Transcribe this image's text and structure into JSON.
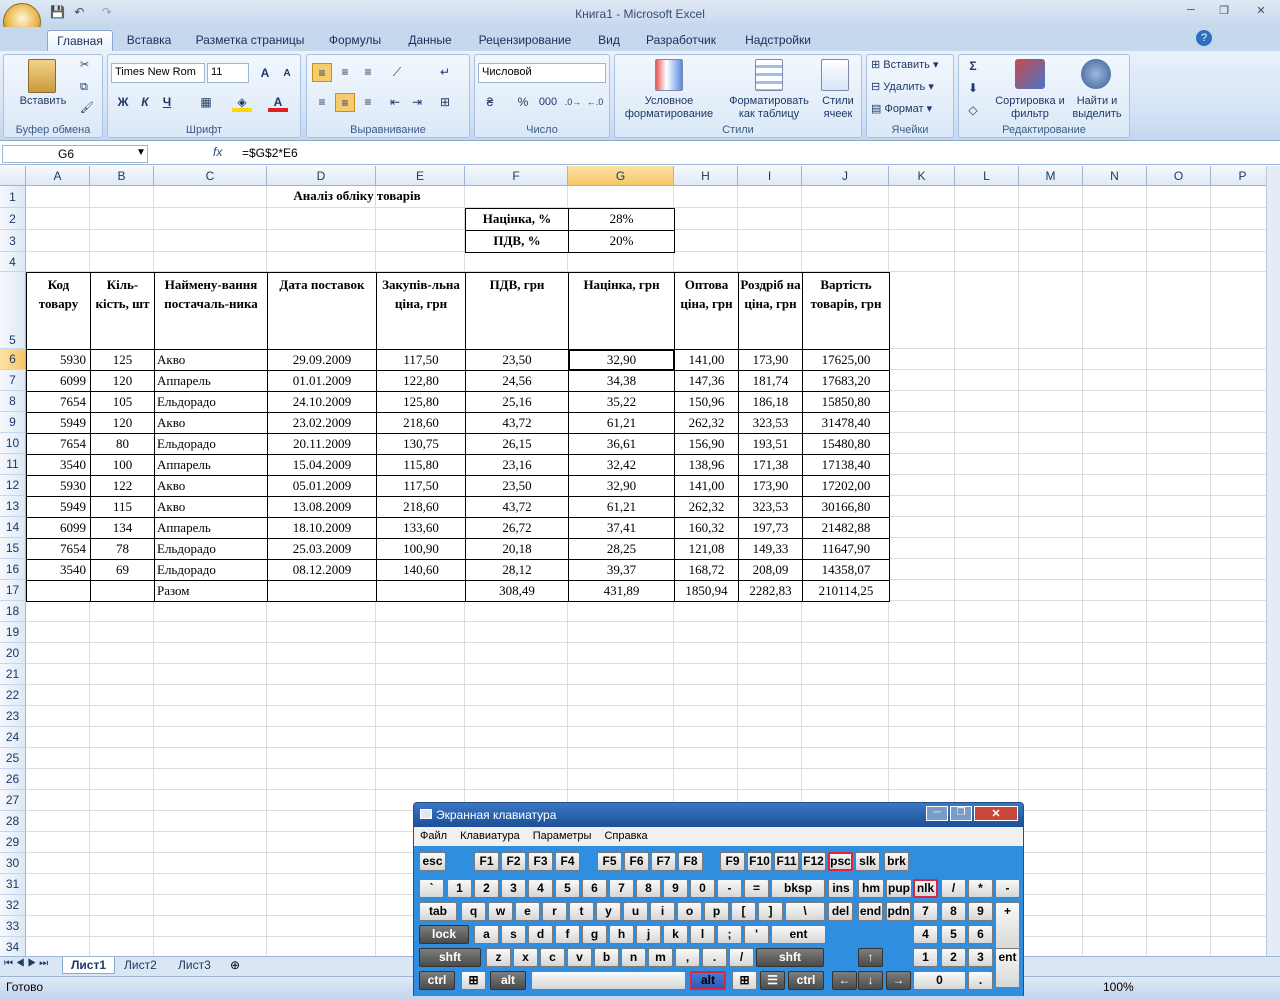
{
  "window": {
    "title": "Книга1 - Microsoft Excel"
  },
  "qat": {
    "save": "💾",
    "undo": "↶",
    "redo": "↷"
  },
  "ribbon": {
    "tabs": [
      "Главная",
      "Вставка",
      "Разметка страницы",
      "Формулы",
      "Данные",
      "Рецензирование",
      "Вид",
      "Разработчик",
      "Надстройки"
    ],
    "active_tab": "Главная",
    "groups": {
      "clipboard": {
        "label": "Буфер обмена",
        "paste": "Вставить"
      },
      "font": {
        "label": "Шрифт",
        "font_name": "Times New Rom",
        "font_size": "11",
        "bold": "Ж",
        "italic": "К",
        "underline": "Ч"
      },
      "alignment": {
        "label": "Выравнивание"
      },
      "number": {
        "label": "Число",
        "format": "Числовой",
        "percent": "%",
        "thousands": "000"
      },
      "styles": {
        "label": "Стили",
        "conditional": "Условное форматирование",
        "as_table": "Форматировать как таблицу",
        "cell_styles": "Стили ячеек"
      },
      "cells": {
        "label": "Ячейки",
        "insert": "Вставить",
        "delete": "Удалить",
        "format": "Формат"
      },
      "editing": {
        "label": "Редактирование",
        "sum": "Σ",
        "sort": "Сортировка и фильтр",
        "find": "Найти и выделить"
      }
    }
  },
  "formula_bar": {
    "name_box": "G6",
    "fx": "fx",
    "formula": "=$G$2*E6"
  },
  "columns": [
    "A",
    "B",
    "C",
    "D",
    "E",
    "F",
    "G",
    "H",
    "I",
    "J",
    "K",
    "L",
    "M",
    "N",
    "O",
    "P"
  ],
  "selected_column": "G",
  "selected_row": 6,
  "sheet": {
    "title": "Аналіз обліку товарів",
    "markup_label": "Націнка, %",
    "markup_value": "28%",
    "vat_label": "ПДВ, %",
    "vat_value": "20%",
    "headers": [
      "Код товару",
      "Кіль-кість, шт",
      "Наймену-вання постачаль-ника",
      "Дата поставок",
      "Закупів-льна ціна, грн",
      "ПДВ, грн",
      "Націнка, грн",
      "Оптова ціна, грн",
      "Роздріб на ціна, грн",
      "Вартість товарів, грн"
    ],
    "rows": [
      [
        "5930",
        "125",
        "Акво",
        "29.09.2009",
        "117,50",
        "23,50",
        "32,90",
        "141,00",
        "173,90",
        "17625,00"
      ],
      [
        "6099",
        "120",
        "Аппарель",
        "01.01.2009",
        "122,80",
        "24,56",
        "34,38",
        "147,36",
        "181,74",
        "17683,20"
      ],
      [
        "7654",
        "105",
        "Ельдорадо",
        "24.10.2009",
        "125,80",
        "25,16",
        "35,22",
        "150,96",
        "186,18",
        "15850,80"
      ],
      [
        "5949",
        "120",
        "Акво",
        "23.02.2009",
        "218,60",
        "43,72",
        "61,21",
        "262,32",
        "323,53",
        "31478,40"
      ],
      [
        "7654",
        "80",
        "Ельдорадо",
        "20.11.2009",
        "130,75",
        "26,15",
        "36,61",
        "156,90",
        "193,51",
        "15480,80"
      ],
      [
        "3540",
        "100",
        "Аппарель",
        "15.04.2009",
        "115,80",
        "23,16",
        "32,42",
        "138,96",
        "171,38",
        "17138,40"
      ],
      [
        "5930",
        "122",
        "Акво",
        "05.01.2009",
        "117,50",
        "23,50",
        "32,90",
        "141,00",
        "173,90",
        "17202,00"
      ],
      [
        "5949",
        "115",
        "Акво",
        "13.08.2009",
        "218,60",
        "43,72",
        "61,21",
        "262,32",
        "323,53",
        "30166,80"
      ],
      [
        "6099",
        "134",
        "Аппарель",
        "18.10.2009",
        "133,60",
        "26,72",
        "37,41",
        "160,32",
        "197,73",
        "21482,88"
      ],
      [
        "7654",
        "78",
        "Ельдорадо",
        "25.03.2009",
        "100,90",
        "20,18",
        "28,25",
        "121,08",
        "149,33",
        "11647,90"
      ],
      [
        "3540",
        "69",
        "Ельдорадо",
        "08.12.2009",
        "140,60",
        "28,12",
        "39,37",
        "168,72",
        "208,09",
        "14358,07"
      ]
    ],
    "total_row": [
      "",
      "",
      "Разом",
      "",
      "",
      "308,49",
      "431,89",
      "1850,94",
      "2282,83",
      "210114,25"
    ]
  },
  "sheet_tabs": [
    "Лист1",
    "Лист2",
    "Лист3"
  ],
  "status": {
    "ready": "Готово",
    "zoom": "100%"
  },
  "osk": {
    "title": "Экранная клавиатура",
    "menu": [
      "Файл",
      "Клавиатура",
      "Параметры",
      "Справка"
    ],
    "row1": [
      "esc",
      "F1",
      "F2",
      "F3",
      "F4",
      "F5",
      "F6",
      "F7",
      "F8",
      "F9",
      "F10",
      "F11",
      "F12",
      "psc",
      "slk",
      "brk"
    ],
    "row2": [
      "`",
      "1",
      "2",
      "3",
      "4",
      "5",
      "6",
      "7",
      "8",
      "9",
      "0",
      "-",
      "=",
      "bksp",
      "ins",
      "hm",
      "pup",
      "nlk",
      "/",
      "*",
      "-"
    ],
    "row3": [
      "tab",
      "q",
      "w",
      "e",
      "r",
      "t",
      "y",
      "u",
      "i",
      "o",
      "p",
      "[",
      "]",
      "\\",
      "del",
      "end",
      "pdn",
      "7",
      "8",
      "9",
      "+"
    ],
    "row4": [
      "lock",
      "a",
      "s",
      "d",
      "f",
      "g",
      "h",
      "j",
      "k",
      "l",
      ";",
      "'",
      "ent",
      "4",
      "5",
      "6"
    ],
    "row5": [
      "shft",
      "z",
      "x",
      "c",
      "v",
      "b",
      "n",
      "m",
      ",",
      ".",
      "/",
      "shft",
      "↑",
      "1",
      "2",
      "3",
      "ent"
    ],
    "row6": [
      "ctrl",
      "alt",
      "alt",
      "ctrl",
      "←",
      "↓",
      "→",
      "0",
      "."
    ]
  }
}
